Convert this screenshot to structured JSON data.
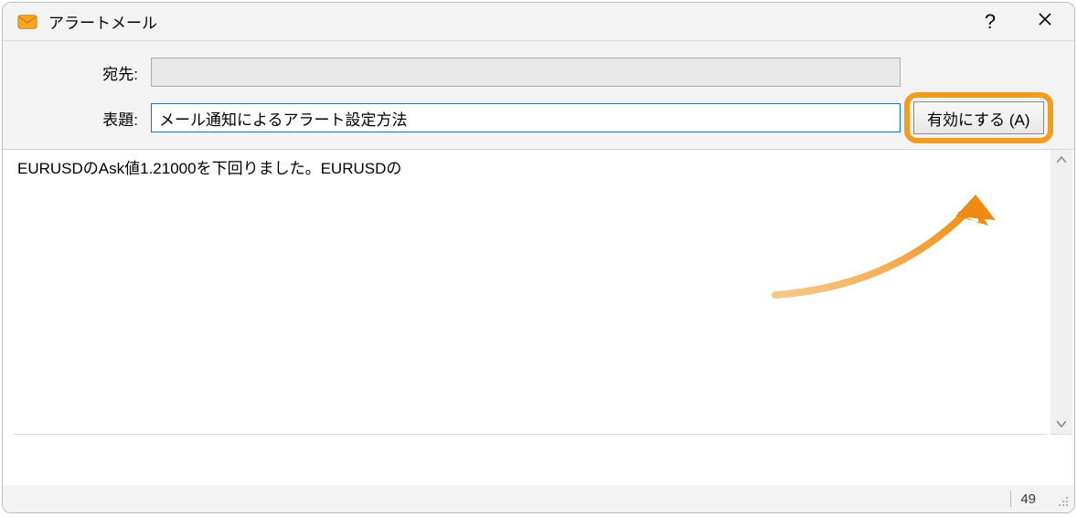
{
  "window": {
    "title": "アラートメール"
  },
  "form": {
    "to_label": "宛先:",
    "to_value": "",
    "subject_label": "表題:",
    "subject_value": "メール通知によるアラート設定方法",
    "enable_button": "有効にする (A)"
  },
  "body": {
    "text": "EURUSDのAsk値1.21000を下回りました。EURUSDの"
  },
  "status": {
    "char_count": "49"
  },
  "icons": {
    "app": "mail-icon",
    "help": "help-icon",
    "close": "close-icon",
    "scroll_up": "chevron-up-icon",
    "scroll_down": "chevron-down-icon",
    "resize": "resize-grip-icon"
  },
  "annotation": {
    "highlight": "enable-button-highlight",
    "arrow": "annotation-arrow"
  }
}
